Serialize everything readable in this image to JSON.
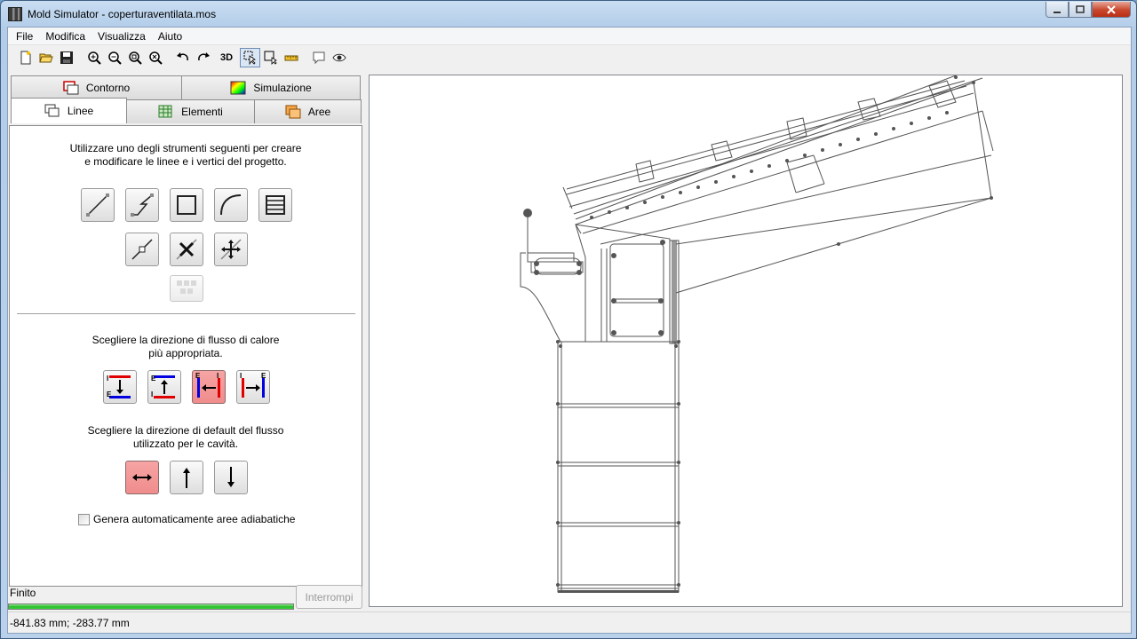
{
  "window": {
    "title": "Mold Simulator - coperturaventilata.mos",
    "controls": [
      "minimize",
      "maximize",
      "close"
    ]
  },
  "menu": [
    "File",
    "Modifica",
    "Visualizza",
    "Aiuto"
  ],
  "toolbar": {
    "icons": [
      "new-file-icon",
      "open-folder-icon",
      "save-icon",
      "zoom-in-icon",
      "zoom-out-icon",
      "zoom-window-icon",
      "zoom-fit-icon",
      "undo-icon",
      "redo-icon"
    ],
    "btn_3d": "3D",
    "selected_tool": "select-pointer-icon"
  },
  "tabs": {
    "row1": [
      {
        "label": "Contorno",
        "icon": "contour-icon"
      },
      {
        "label": "Simulazione",
        "icon": "simulation-icon"
      }
    ],
    "row2": [
      {
        "label": "Linee",
        "icon": "lines-icon",
        "selected": true
      },
      {
        "label": "Elementi",
        "icon": "elements-icon"
      },
      {
        "label": "Aree",
        "icon": "areas-icon"
      }
    ]
  },
  "panel": {
    "intro_line1": "Utilizzare uno degli strumenti seguenti per creare",
    "intro_line2": "e modificare le linee e i vertici del progetto.",
    "flow_line1": "Scegliere la direzione di flusso di calore",
    "flow_line2": "più appropriata.",
    "default_line1": "Scegliere la direzione di default del flusso",
    "default_line2": "utilizzato per le cavità.",
    "checkbox_label": "Genera automaticamente aree adiabatiche",
    "checkbox_checked": false,
    "flow_letters": {
      "interior": "I",
      "exterior": "E"
    }
  },
  "status": {
    "text": "Finito",
    "progress": 1.0,
    "stop_label": "Interrompi",
    "coords": "-841.83 mm; -283.77 mm"
  },
  "colors": {
    "accent_red": "#f08c8c",
    "progress_green": "#2bbb2b",
    "flow_red": "#e00000",
    "flow_blue": "#0000e0"
  }
}
